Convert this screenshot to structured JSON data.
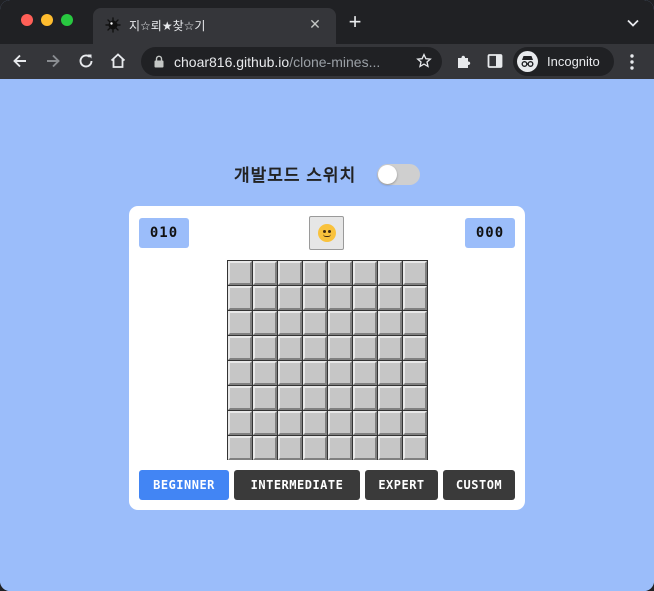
{
  "browser": {
    "tab_title": "지☆뢰★찾☆기",
    "url_host": "choar816.github.io",
    "url_path": "/clone-mines...",
    "profile_label": "Incognito",
    "colors": {
      "frame": "#202124",
      "toolbar": "#35363a",
      "page_bg": "#9bbdfa"
    },
    "icons": [
      "bug-favicon-icon",
      "close-icon",
      "plus-icon",
      "chevron-down-icon",
      "back-icon",
      "forward-icon",
      "reload-icon",
      "home-icon",
      "lock-icon",
      "star-icon",
      "extensions-icon",
      "sidepanel-icon",
      "incognito-icon",
      "kebab-menu-icon"
    ]
  },
  "game": {
    "dev_mode_label": "개발모드 스위치",
    "dev_mode_on": false,
    "mine_counter": "010",
    "timer": "000",
    "face": "slightly-smiling-face",
    "board": {
      "rows": 8,
      "cols": 8,
      "revealed": 0
    },
    "difficulties": [
      {
        "label": "BEGINNER",
        "active": true
      },
      {
        "label": "INTERMEDIATE",
        "active": false
      },
      {
        "label": "EXPERT",
        "active": false
      },
      {
        "label": "CUSTOM",
        "active": false
      }
    ],
    "colors": {
      "accent": "#4285f4",
      "button": "#3a3a3a",
      "counter_bg": "#9bbdfa",
      "cell": "#c6c6c6"
    }
  }
}
